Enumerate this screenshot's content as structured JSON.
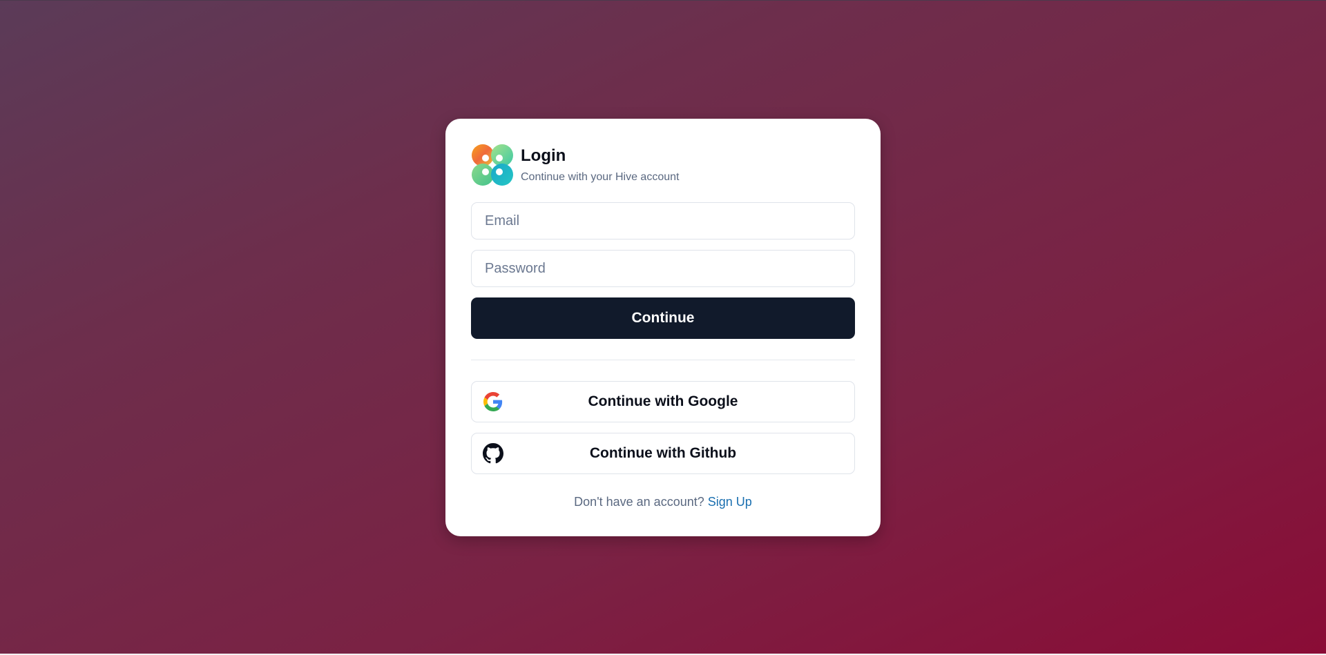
{
  "header": {
    "title": "Login",
    "subtitle": "Continue with your Hive account"
  },
  "form": {
    "email_placeholder": "Email",
    "email_value": "",
    "password_placeholder": "Password",
    "password_value": "",
    "continue_label": "Continue"
  },
  "oauth": {
    "google_label": "Continue with Google",
    "google_icon": "google-icon",
    "github_label": "Continue with Github",
    "github_icon": "github-icon"
  },
  "footer": {
    "prompt": "Don't have an account?",
    "signup_label": "Sign Up"
  },
  "colors": {
    "primary_button": "#111a2b",
    "link": "#1a6fb0",
    "background_start": "#5b3b58",
    "background_end": "#8a0c36"
  }
}
